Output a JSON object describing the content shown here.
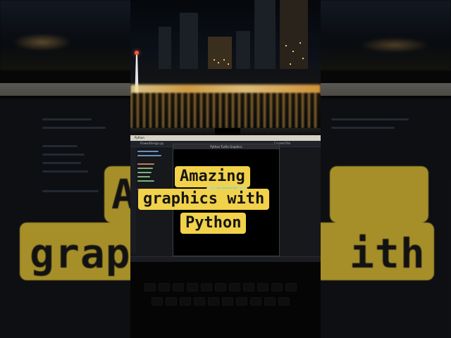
{
  "caption": {
    "line1": "Amazing",
    "line2": "graphics with",
    "line3": "Python"
  },
  "background_caption": {
    "left": "A",
    "mid": "grap",
    "right": "ith"
  },
  "ide": {
    "app_name": "Python",
    "tab": "FlowerDesign.py",
    "turtle_window_title": "Python Turtle Graphics",
    "run_config": "Current File"
  },
  "colors": {
    "caption_bg": "#f1d24a",
    "caption_text": "#151515"
  },
  "icons": [
    "tower-landmark",
    "flower-graphic"
  ]
}
